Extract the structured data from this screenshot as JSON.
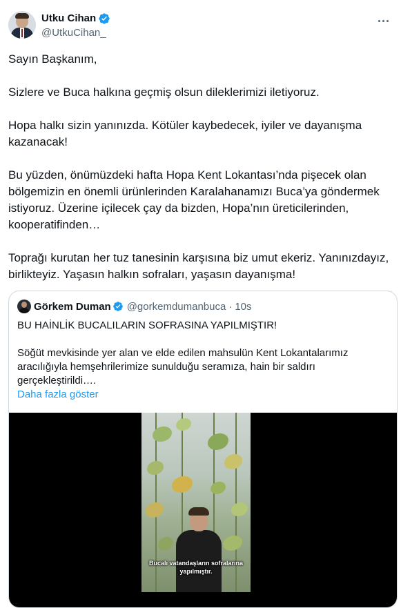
{
  "author": {
    "display_name": "Utku Cihan",
    "handle": "@UtkuCihan_"
  },
  "tweet": {
    "paragraphs": [
      "Sayın Başkanım,",
      "Sizlere ve Buca halkına geçmiş olsun dileklerimizi iletiyoruz.",
      "Hopa halkı sizin yanınızda. Kötüler kaybedecek, iyiler ve dayanışma\nkazanacak!",
      "Bu yüzden, önümüzdeki hafta Hopa Kent Lokantası’nda pişecek olan\nbölgemizin en önemli ürünlerinden Karalahanamızı Buca’ya göndermek\nistiyoruz. Üzerine içilecek çay da bizden, Hopa’nın üreticilerinden,\nkooperatifinden…",
      "Toprağı kurutan her tuz tanesinin karşısına biz umut ekeriz. Yanınızdayız,\nbirlikteyiz. Yaşasın halkın sofraları, yaşasın dayanışma!"
    ]
  },
  "quote": {
    "display_name": "Görkem Duman",
    "handle": "@gorkemdumanbuca",
    "separator": "·",
    "time": "10s",
    "headline": "BU HAİNLİK BUCALILARIN SOFRASINA YAPILMIŞTIR!",
    "body": "Söğüt mevkisinde yer alan ve elde edilen mahsulün Kent Lokantalarımız\naracılığıyla hemşehrilerimize sunulduğu seramıza, hain bir saldırı\ngerçekleştirildi….",
    "show_more": "Daha fazla göster",
    "video_caption": "Bucalı vatandaşların sofralarına\nyapılmıştır."
  },
  "colors": {
    "text": "#0f1419",
    "secondary": "#536471",
    "link": "#1d9bf0",
    "verified": "#1d9bf0",
    "border": "#cfd9de"
  },
  "icons": [
    "verified-badge-icon",
    "more-icon"
  ]
}
